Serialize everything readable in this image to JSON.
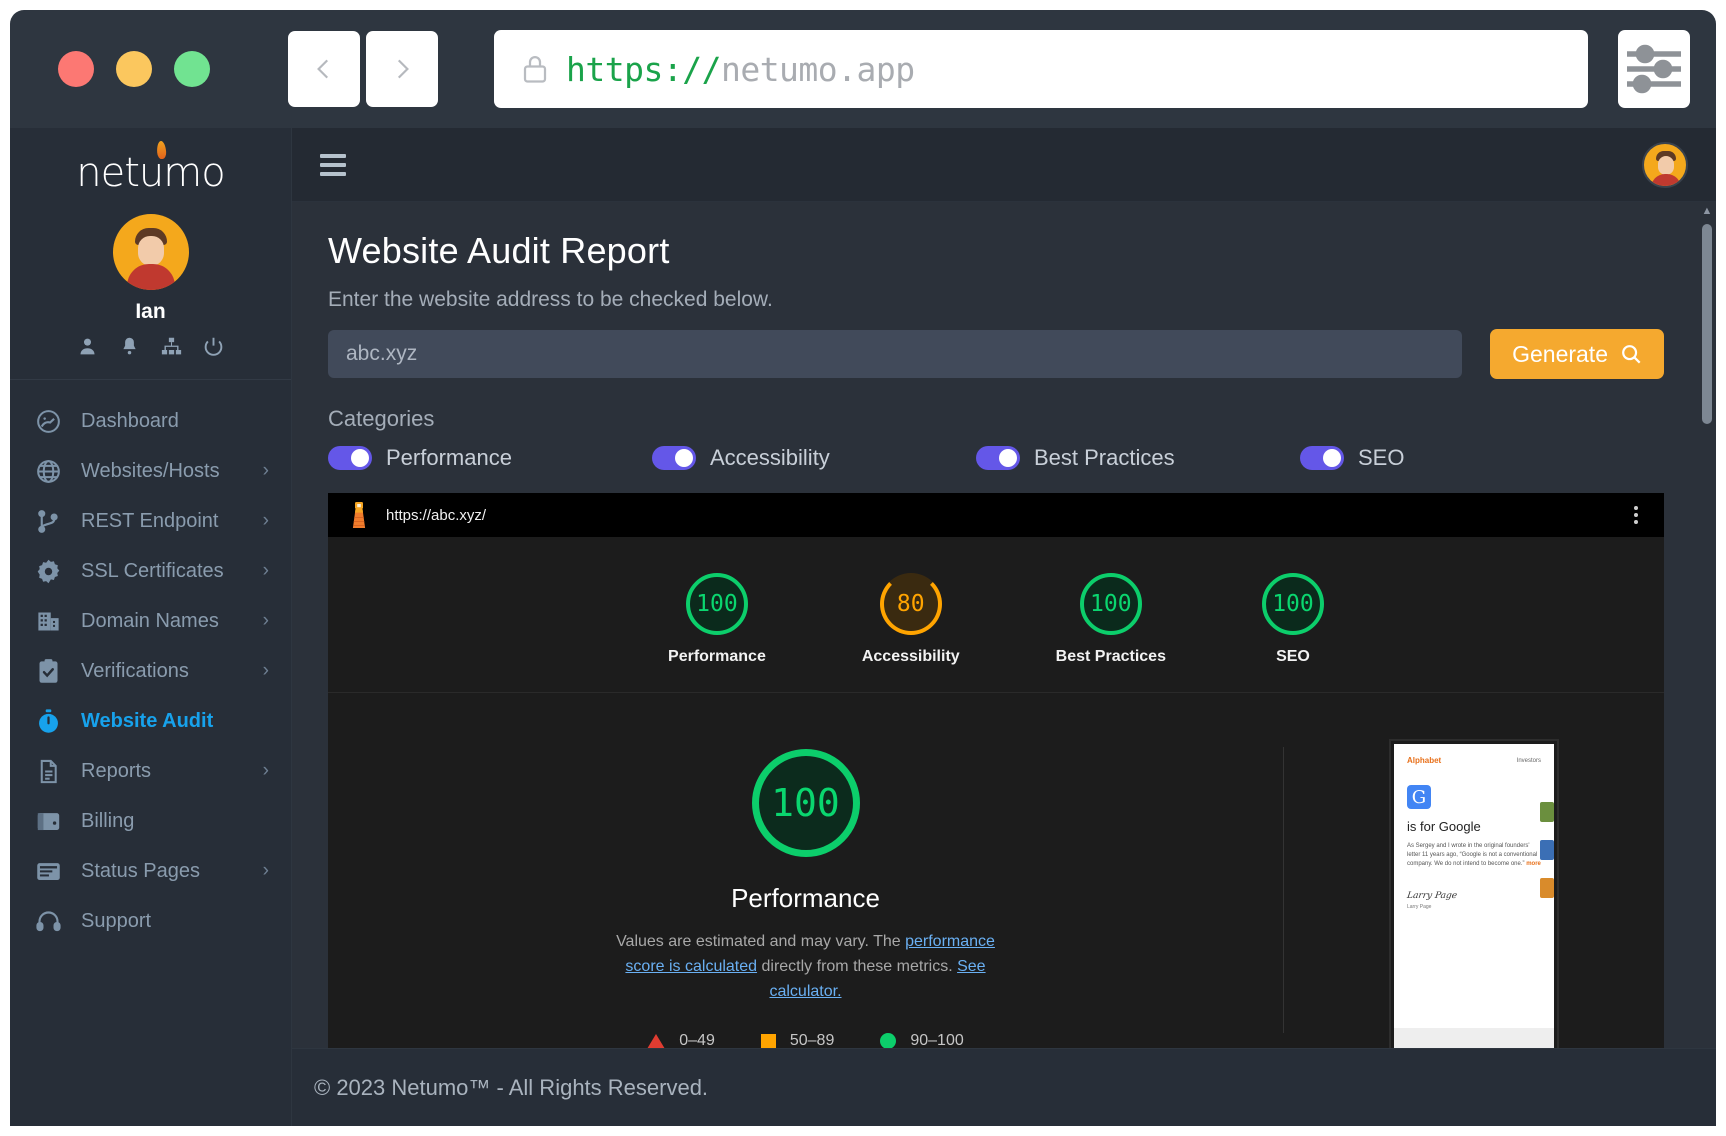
{
  "browser": {
    "url_protocol": "https://",
    "url_host": "netumo.app",
    "back_label": "Back",
    "forward_label": "Forward"
  },
  "sidebar": {
    "logo": "netumo",
    "user_name": "Ian",
    "user_icons": [
      "user-icon",
      "bell-icon",
      "sitemap-icon",
      "power-icon"
    ],
    "items": [
      {
        "label": "Dashboard",
        "icon": "gauge-icon",
        "has_chevron": false,
        "active": false
      },
      {
        "label": "Websites/Hosts",
        "icon": "globe-icon",
        "has_chevron": true,
        "active": false
      },
      {
        "label": "REST Endpoint",
        "icon": "branch-icon",
        "has_chevron": true,
        "active": false
      },
      {
        "label": "SSL Certificates",
        "icon": "badge-icon",
        "has_chevron": true,
        "active": false
      },
      {
        "label": "Domain Names",
        "icon": "building-icon",
        "has_chevron": true,
        "active": false
      },
      {
        "label": "Verifications",
        "icon": "clipboard-check-icon",
        "has_chevron": true,
        "active": false
      },
      {
        "label": "Website Audit",
        "icon": "stopwatch-icon",
        "has_chevron": false,
        "active": true
      },
      {
        "label": "Reports",
        "icon": "document-icon",
        "has_chevron": true,
        "active": false
      },
      {
        "label": "Billing",
        "icon": "wallet-icon",
        "has_chevron": false,
        "active": false
      },
      {
        "label": "Status Pages",
        "icon": "window-icon",
        "has_chevron": true,
        "active": false
      },
      {
        "label": "Support",
        "icon": "headset-icon",
        "has_chevron": false,
        "active": false
      }
    ]
  },
  "topbar": {
    "menu_toggle": "hamburger-icon",
    "avatar": "user-avatar"
  },
  "main": {
    "title": "Website Audit Report",
    "subtitle": "Enter the website address to be checked below.",
    "input_placeholder": "abc.xyz",
    "input_value": "",
    "generate_label": "Generate",
    "categories_label": "Categories",
    "categories": [
      {
        "label": "Performance",
        "enabled": true
      },
      {
        "label": "Accessibility",
        "enabled": true
      },
      {
        "label": "Best Practices",
        "enabled": true
      },
      {
        "label": "SEO",
        "enabled": true
      }
    ]
  },
  "report": {
    "audited_url": "https://abc.xyz/",
    "scores": [
      {
        "name": "Performance",
        "value": "100",
        "state": "pass"
      },
      {
        "name": "Accessibility",
        "value": "80",
        "state": "average"
      },
      {
        "name": "Best Practices",
        "value": "100",
        "state": "pass"
      },
      {
        "name": "SEO",
        "value": "100",
        "state": "pass"
      }
    ],
    "detail": {
      "value": "100",
      "name": "Performance",
      "desc_1": "Values are estimated and may vary. The ",
      "link_1": "performance score is calculated",
      "desc_2": " directly from these metrics. ",
      "link_2": "See calculator."
    },
    "legend": [
      {
        "shape": "triangle",
        "range": "0–49",
        "color": "#e03c31"
      },
      {
        "shape": "square",
        "range": "50–89",
        "color": "#ffa400"
      },
      {
        "shape": "circle",
        "range": "90–100",
        "color": "#0cce6b"
      }
    ],
    "thumbnail": {
      "brand": "Alphabet",
      "nav": "Investors",
      "logo_letter": "G",
      "headline": "is for Google",
      "body": "As Sergey and I wrote in the original founders' letter 11 years ago, “Google is not a conventional company. We do not intend to become one.”",
      "more": "more",
      "signature": "Larry Page",
      "signature_sub": "Larry Page"
    }
  },
  "footer": {
    "text": "© 2023 Netumo™ - All Rights Reserved."
  },
  "colors": {
    "accent_blue": "#17a2ec",
    "accent_orange": "#f5a92f",
    "toggle_purple": "#6457e8",
    "score_pass": "#0cce6b",
    "score_average": "#ffa400",
    "score_fail": "#e03c31"
  }
}
